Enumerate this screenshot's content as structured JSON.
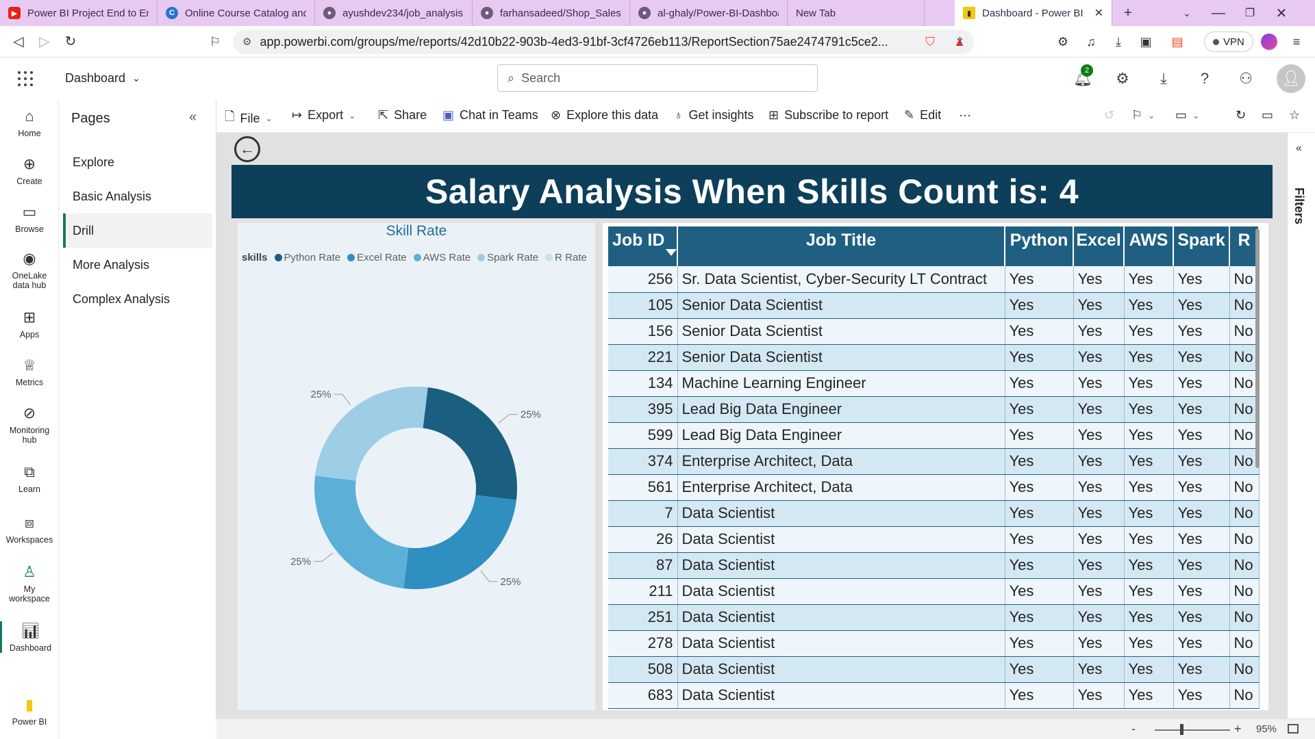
{
  "browser": {
    "tabs": [
      {
        "label": "Power BI Project End to End",
        "icon": "youtube-icon",
        "color": "#e62117"
      },
      {
        "label": "Online Course Catalog and",
        "icon": "coursera-icon",
        "color": "#2a73cc"
      },
      {
        "label": "ayushdev234/job_analysis",
        "icon": "github-icon",
        "color": "#6e5a7a"
      },
      {
        "label": "farhansadeed/Shop_Sales_P",
        "icon": "github-icon",
        "color": "#6e5a7a"
      },
      {
        "label": "al-ghaly/Power-BI-Dashboa",
        "icon": "github-icon",
        "color": "#6e5a7a"
      },
      {
        "label": "New Tab",
        "icon": "",
        "color": ""
      }
    ],
    "active_tab": {
      "label": "Dashboard - Power BI",
      "icon": "powerbi-icon"
    },
    "url": "app.powerbi.com/groups/me/reports/42d10b22-903b-4ed3-91bf-3cf4726eb113/ReportSection75ae2474791c5ce2...",
    "brave_badge": "1",
    "vpn_label": "VPN"
  },
  "header": {
    "workspace_title": "Dashboard",
    "search_placeholder": "Search",
    "notification_count": "2"
  },
  "rail": {
    "items": [
      {
        "label": "Home",
        "icon": "home-icon"
      },
      {
        "label": "Create",
        "icon": "plus-circle-icon"
      },
      {
        "label": "Browse",
        "icon": "folder-icon"
      },
      {
        "label": "OneLake data hub",
        "icon": "onelake-icon"
      },
      {
        "label": "Apps",
        "icon": "apps-icon"
      },
      {
        "label": "Metrics",
        "icon": "trophy-icon"
      },
      {
        "label": "Monitoring hub",
        "icon": "monitor-icon"
      },
      {
        "label": "Learn",
        "icon": "book-icon"
      },
      {
        "label": "Workspaces",
        "icon": "workspaces-icon"
      },
      {
        "label": "My workspace",
        "icon": "person-icon"
      },
      {
        "label": "Dashboard",
        "icon": "report-icon"
      },
      {
        "label": "Power BI",
        "icon": "powerbi-logo-icon"
      }
    ]
  },
  "pages": {
    "title": "Pages",
    "items": [
      "Explore",
      "Basic Analysis",
      "Drill",
      "More Analysis",
      "Complex Analysis"
    ],
    "active": "Drill"
  },
  "actionbar": {
    "file": "File",
    "export": "Export",
    "share": "Share",
    "chat": "Chat in Teams",
    "explore": "Explore this data",
    "insights": "Get insights",
    "subscribe": "Subscribe to report",
    "edit": "Edit",
    "more": "···"
  },
  "report": {
    "banner": "Salary Analysis When Skills Count is: 4",
    "donut": {
      "title": "Skill Rate",
      "legend_title": "skills",
      "colors": [
        "#1a5e80",
        "#2e8fc0",
        "#5cb0d8",
        "#9ecde6",
        "#c9e3f1"
      ]
    },
    "table": {
      "headers": [
        "Job ID",
        "Job Title",
        "Python",
        "Excel",
        "AWS",
        "Spark",
        "R"
      ],
      "rows": [
        [
          "256",
          "Sr. Data Scientist, Cyber-Security LT Contract",
          "Yes",
          "Yes",
          "Yes",
          "Yes",
          "No"
        ],
        [
          "105",
          "Senior Data Scientist",
          "Yes",
          "Yes",
          "Yes",
          "Yes",
          "No"
        ],
        [
          "156",
          "Senior Data Scientist",
          "Yes",
          "Yes",
          "Yes",
          "Yes",
          "No"
        ],
        [
          "221",
          "Senior Data Scientist",
          "Yes",
          "Yes",
          "Yes",
          "Yes",
          "No"
        ],
        [
          "134",
          "Machine Learning Engineer",
          "Yes",
          "Yes",
          "Yes",
          "Yes",
          "No"
        ],
        [
          "395",
          "Lead Big Data Engineer",
          "Yes",
          "Yes",
          "Yes",
          "Yes",
          "No"
        ],
        [
          "599",
          "Lead Big Data Engineer",
          "Yes",
          "Yes",
          "Yes",
          "Yes",
          "No"
        ],
        [
          "374",
          "Enterprise Architect, Data",
          "Yes",
          "Yes",
          "Yes",
          "Yes",
          "No"
        ],
        [
          "561",
          "Enterprise Architect, Data",
          "Yes",
          "Yes",
          "Yes",
          "Yes",
          "No"
        ],
        [
          "7",
          "Data Scientist",
          "Yes",
          "Yes",
          "Yes",
          "Yes",
          "No"
        ],
        [
          "26",
          "Data Scientist",
          "Yes",
          "Yes",
          "Yes",
          "Yes",
          "No"
        ],
        [
          "87",
          "Data Scientist",
          "Yes",
          "Yes",
          "Yes",
          "Yes",
          "No"
        ],
        [
          "211",
          "Data Scientist",
          "Yes",
          "Yes",
          "Yes",
          "Yes",
          "No"
        ],
        [
          "251",
          "Data Scientist",
          "Yes",
          "Yes",
          "Yes",
          "Yes",
          "No"
        ],
        [
          "278",
          "Data Scientist",
          "Yes",
          "Yes",
          "Yes",
          "Yes",
          "No"
        ],
        [
          "508",
          "Data Scientist",
          "Yes",
          "Yes",
          "Yes",
          "Yes",
          "No"
        ],
        [
          "683",
          "Data Scientist",
          "Yes",
          "Yes",
          "Yes",
          "Yes",
          "No"
        ]
      ]
    }
  },
  "filters": {
    "label": "Filters"
  },
  "zoom": {
    "value": "95%",
    "level": 0.35
  },
  "chart_data": {
    "type": "pie",
    "title": "Skill Rate",
    "legend_title": "skills",
    "categories": [
      "Python Rate",
      "Excel Rate",
      "AWS Rate",
      "Spark Rate",
      "R Rate"
    ],
    "values": [
      25,
      25,
      25,
      25,
      0
    ],
    "data_labels": [
      "25%",
      "25%",
      "25%",
      "25%",
      ""
    ],
    "donut": true,
    "legend_position": "top-left"
  }
}
